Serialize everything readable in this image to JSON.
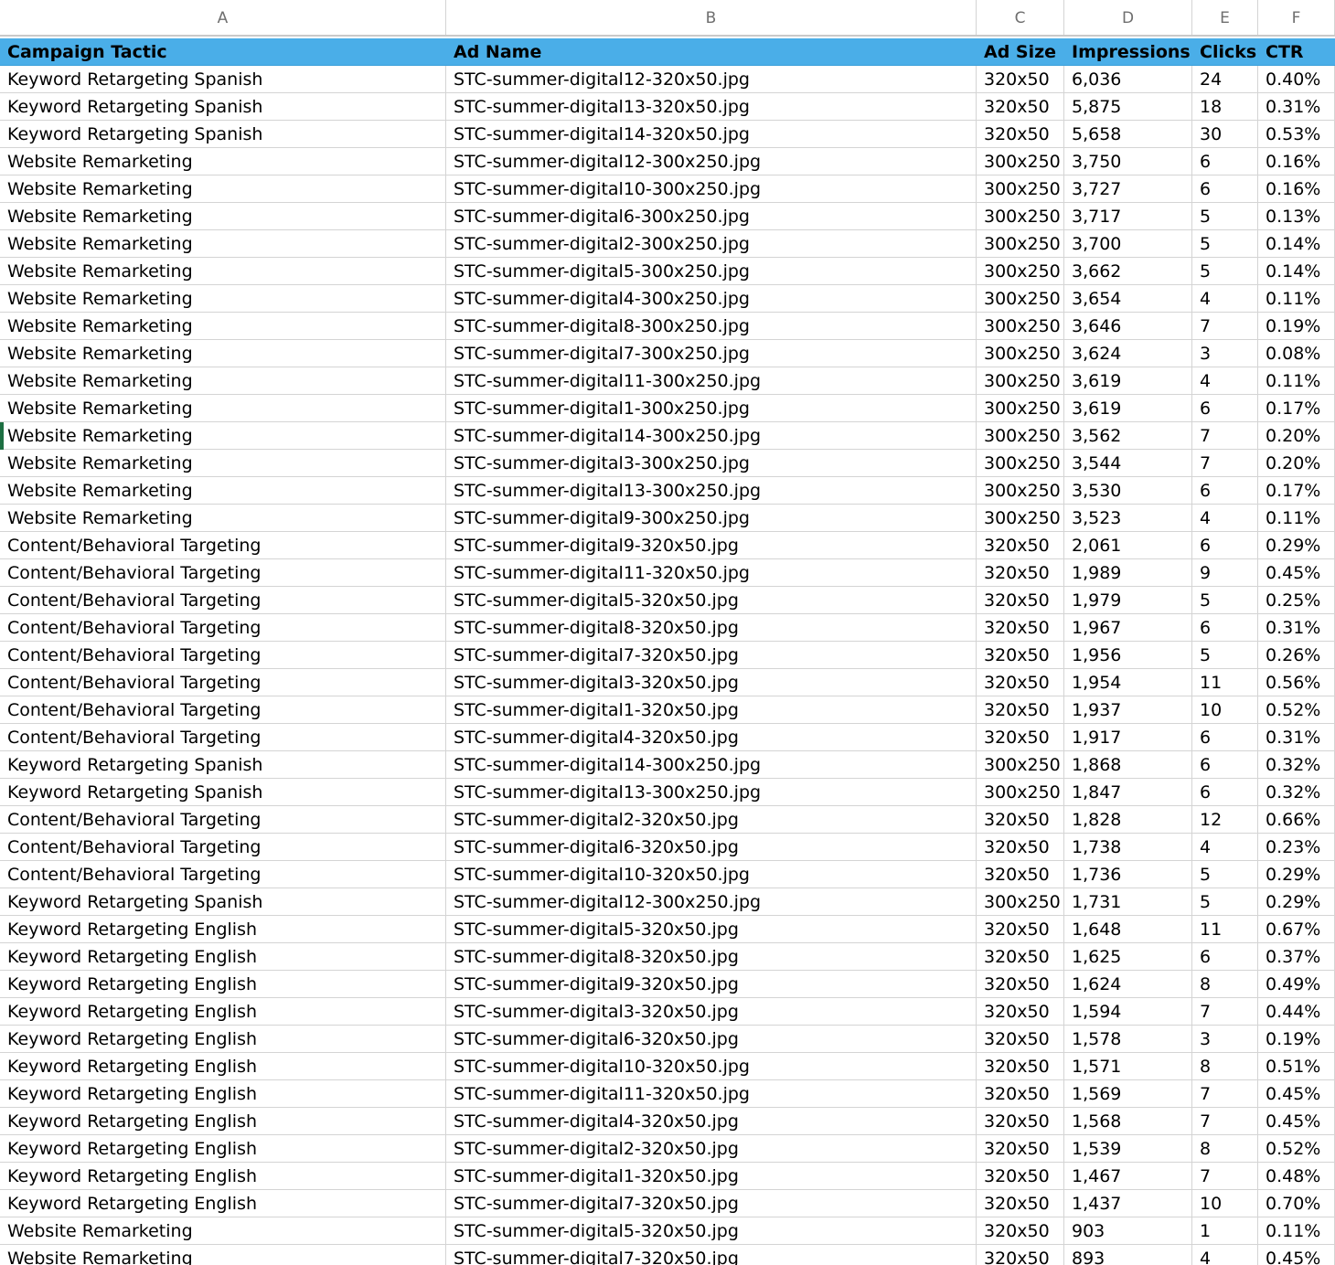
{
  "column_letters": [
    "A",
    "B",
    "C",
    "D",
    "E",
    "F"
  ],
  "headers": [
    "Campaign Tactic",
    "Ad Name",
    "Ad Size",
    "Impressions",
    "Clicks",
    "CTR"
  ],
  "rows": [
    [
      "Keyword Retargeting Spanish",
      "STC-summer-digital12-320x50.jpg",
      "320x50",
      "6,036",
      "24",
      "0.40%"
    ],
    [
      "Keyword Retargeting Spanish",
      "STC-summer-digital13-320x50.jpg",
      "320x50",
      "5,875",
      "18",
      "0.31%"
    ],
    [
      "Keyword Retargeting Spanish",
      "STC-summer-digital14-320x50.jpg",
      "320x50",
      "5,658",
      "30",
      "0.53%"
    ],
    [
      "Website Remarketing",
      "STC-summer-digital12-300x250.jpg",
      "300x250",
      "3,750",
      "6",
      "0.16%"
    ],
    [
      "Website Remarketing",
      "STC-summer-digital10-300x250.jpg",
      "300x250",
      "3,727",
      "6",
      "0.16%"
    ],
    [
      "Website Remarketing",
      "STC-summer-digital6-300x250.jpg",
      "300x250",
      "3,717",
      "5",
      "0.13%"
    ],
    [
      "Website Remarketing",
      "STC-summer-digital2-300x250.jpg",
      "300x250",
      "3,700",
      "5",
      "0.14%"
    ],
    [
      "Website Remarketing",
      "STC-summer-digital5-300x250.jpg",
      "300x250",
      "3,662",
      "5",
      "0.14%"
    ],
    [
      "Website Remarketing",
      "STC-summer-digital4-300x250.jpg",
      "300x250",
      "3,654",
      "4",
      "0.11%"
    ],
    [
      "Website Remarketing",
      "STC-summer-digital8-300x250.jpg",
      "300x250",
      "3,646",
      "7",
      "0.19%"
    ],
    [
      "Website Remarketing",
      "STC-summer-digital7-300x250.jpg",
      "300x250",
      "3,624",
      "3",
      "0.08%"
    ],
    [
      "Website Remarketing",
      "STC-summer-digital11-300x250.jpg",
      "300x250",
      "3,619",
      "4",
      "0.11%"
    ],
    [
      "Website Remarketing",
      "STC-summer-digital1-300x250.jpg",
      "300x250",
      "3,619",
      "6",
      "0.17%"
    ],
    [
      "Website Remarketing",
      "STC-summer-digital14-300x250.jpg",
      "300x250",
      "3,562",
      "7",
      "0.20%"
    ],
    [
      "Website Remarketing",
      "STC-summer-digital3-300x250.jpg",
      "300x250",
      "3,544",
      "7",
      "0.20%"
    ],
    [
      "Website Remarketing",
      "STC-summer-digital13-300x250.jpg",
      "300x250",
      "3,530",
      "6",
      "0.17%"
    ],
    [
      "Website Remarketing",
      "STC-summer-digital9-300x250.jpg",
      "300x250",
      "3,523",
      "4",
      "0.11%"
    ],
    [
      "Content/Behavioral Targeting",
      "STC-summer-digital9-320x50.jpg",
      "320x50",
      "2,061",
      "6",
      "0.29%"
    ],
    [
      "Content/Behavioral Targeting",
      "STC-summer-digital11-320x50.jpg",
      "320x50",
      "1,989",
      "9",
      "0.45%"
    ],
    [
      "Content/Behavioral Targeting",
      "STC-summer-digital5-320x50.jpg",
      "320x50",
      "1,979",
      "5",
      "0.25%"
    ],
    [
      "Content/Behavioral Targeting",
      "STC-summer-digital8-320x50.jpg",
      "320x50",
      "1,967",
      "6",
      "0.31%"
    ],
    [
      "Content/Behavioral Targeting",
      "STC-summer-digital7-320x50.jpg",
      "320x50",
      "1,956",
      "5",
      "0.26%"
    ],
    [
      "Content/Behavioral Targeting",
      "STC-summer-digital3-320x50.jpg",
      "320x50",
      "1,954",
      "11",
      "0.56%"
    ],
    [
      "Content/Behavioral Targeting",
      "STC-summer-digital1-320x50.jpg",
      "320x50",
      "1,937",
      "10",
      "0.52%"
    ],
    [
      "Content/Behavioral Targeting",
      "STC-summer-digital4-320x50.jpg",
      "320x50",
      "1,917",
      "6",
      "0.31%"
    ],
    [
      "Keyword Retargeting Spanish",
      "STC-summer-digital14-300x250.jpg",
      "300x250",
      "1,868",
      "6",
      "0.32%"
    ],
    [
      "Keyword Retargeting Spanish",
      "STC-summer-digital13-300x250.jpg",
      "300x250",
      "1,847",
      "6",
      "0.32%"
    ],
    [
      "Content/Behavioral Targeting",
      "STC-summer-digital2-320x50.jpg",
      "320x50",
      "1,828",
      "12",
      "0.66%"
    ],
    [
      "Content/Behavioral Targeting",
      "STC-summer-digital6-320x50.jpg",
      "320x50",
      "1,738",
      "4",
      "0.23%"
    ],
    [
      "Content/Behavioral Targeting",
      "STC-summer-digital10-320x50.jpg",
      "320x50",
      "1,736",
      "5",
      "0.29%"
    ],
    [
      "Keyword Retargeting Spanish",
      "STC-summer-digital12-300x250.jpg",
      "300x250",
      "1,731",
      "5",
      "0.29%"
    ],
    [
      "Keyword Retargeting English",
      "STC-summer-digital5-320x50.jpg",
      "320x50",
      "1,648",
      "11",
      "0.67%"
    ],
    [
      "Keyword Retargeting English",
      "STC-summer-digital8-320x50.jpg",
      "320x50",
      "1,625",
      "6",
      "0.37%"
    ],
    [
      "Keyword Retargeting English",
      "STC-summer-digital9-320x50.jpg",
      "320x50",
      "1,624",
      "8",
      "0.49%"
    ],
    [
      "Keyword Retargeting English",
      "STC-summer-digital3-320x50.jpg",
      "320x50",
      "1,594",
      "7",
      "0.44%"
    ],
    [
      "Keyword Retargeting English",
      "STC-summer-digital6-320x50.jpg",
      "320x50",
      "1,578",
      "3",
      "0.19%"
    ],
    [
      "Keyword Retargeting English",
      "STC-summer-digital10-320x50.jpg",
      "320x50",
      "1,571",
      "8",
      "0.51%"
    ],
    [
      "Keyword Retargeting English",
      "STC-summer-digital11-320x50.jpg",
      "320x50",
      "1,569",
      "7",
      "0.45%"
    ],
    [
      "Keyword Retargeting English",
      "STC-summer-digital4-320x50.jpg",
      "320x50",
      "1,568",
      "7",
      "0.45%"
    ],
    [
      "Keyword Retargeting English",
      "STC-summer-digital2-320x50.jpg",
      "320x50",
      "1,539",
      "8",
      "0.52%"
    ],
    [
      "Keyword Retargeting English",
      "STC-summer-digital1-320x50.jpg",
      "320x50",
      "1,467",
      "7",
      "0.48%"
    ],
    [
      "Keyword Retargeting English",
      "STC-summer-digital7-320x50.jpg",
      "320x50",
      "1,437",
      "10",
      "0.70%"
    ],
    [
      "Website Remarketing",
      "STC-summer-digital5-320x50.jpg",
      "320x50",
      "903",
      "1",
      "0.11%"
    ],
    [
      "Website Remarketing",
      "STC-summer-digital7-320x50.jpg",
      "320x50",
      "893",
      "4",
      "0.45%"
    ]
  ]
}
